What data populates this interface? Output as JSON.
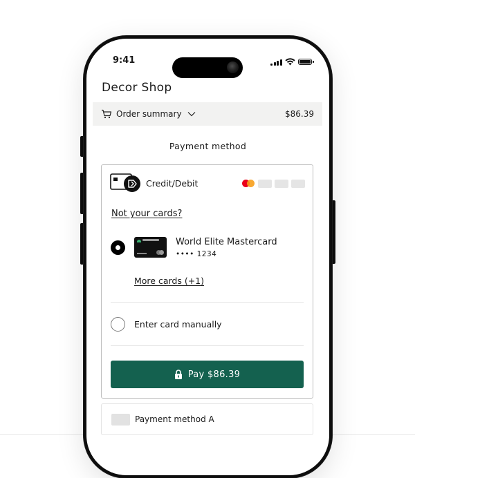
{
  "status_bar": {
    "time": "9:41"
  },
  "shop": {
    "title": "Decor Shop"
  },
  "order_summary": {
    "label": "Order summary",
    "amount": "$86.39"
  },
  "payment": {
    "heading": "Payment method",
    "method_label": "Credit/Debit",
    "not_your_cards": "Not your cards?",
    "saved_card": {
      "name": "World Elite Mastercard",
      "masked_number": "•••• 1234"
    },
    "more_cards": "More cards (+1)",
    "enter_manually": "Enter card manually",
    "pay_button": "Pay $86.39",
    "alt_method": "Payment method A"
  },
  "colors": {
    "pay_button": "#14614f",
    "mastercard_red": "#eb001b",
    "mastercard_orange": "#f79e1b"
  },
  "icons": [
    "cart-icon",
    "chevron-down-icon",
    "card-method-icon",
    "mastercard-icon",
    "lock-icon"
  ]
}
